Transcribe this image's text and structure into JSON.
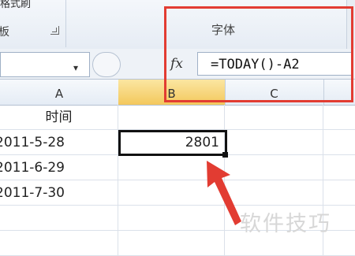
{
  "ribbon": {
    "partial_top_text": "格式刷",
    "left_group_label": "板",
    "right_group_label": "字体"
  },
  "formula_bar": {
    "name_box_value": "",
    "dropdown_glyph": "▾",
    "fx_label": "fx",
    "formula": "=TODAY()-A2"
  },
  "columns": [
    {
      "label": "A",
      "selected": false
    },
    {
      "label": "B",
      "selected": true
    },
    {
      "label": "C",
      "selected": false
    }
  ],
  "rows": [
    {
      "a": "时间",
      "b": ""
    },
    {
      "a": "2011-5-28",
      "b": "2801"
    },
    {
      "a": "2011-6-29",
      "b": ""
    },
    {
      "a": "2011-7-30",
      "b": ""
    },
    {
      "a": "",
      "b": ""
    },
    {
      "a": "",
      "b": ""
    }
  ],
  "active_cell_value": "2801",
  "watermark": "软件技巧",
  "colors": {
    "highlight_red": "#e23c32",
    "selected_header": "#f3c85c"
  }
}
